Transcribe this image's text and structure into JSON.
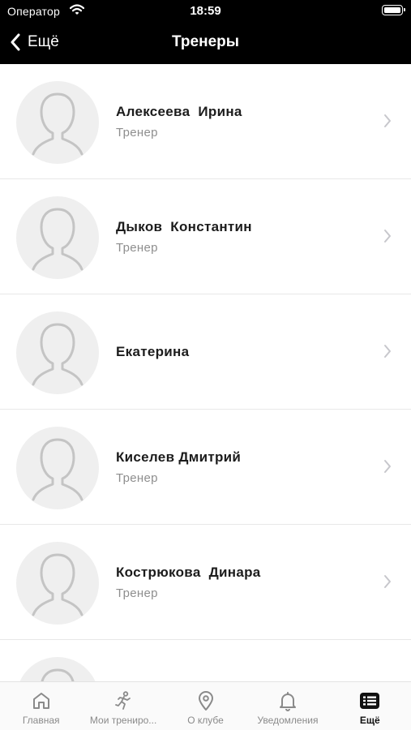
{
  "status_bar": {
    "carrier": "Оператор",
    "time": "18:59"
  },
  "nav": {
    "back_label": "Ещё",
    "title": "Тренеры"
  },
  "trainers": [
    {
      "name": "Алексеева  Ирина",
      "role": "Тренер"
    },
    {
      "name": "Дыков  Константин",
      "role": "Тренер"
    },
    {
      "name": "Екатерина",
      "role": ""
    },
    {
      "name": "Киселев Дмитрий",
      "role": "Тренер"
    },
    {
      "name": "Кострюкова  Динара",
      "role": "Тренер"
    },
    {
      "name": "",
      "role": ""
    }
  ],
  "tabs": [
    {
      "label": "Главная",
      "icon": "home-icon"
    },
    {
      "label": "Мои трениро...",
      "icon": "running-person-icon"
    },
    {
      "label": "О клубе",
      "icon": "location-pin-icon"
    },
    {
      "label": "Уведомления",
      "icon": "bell-icon"
    },
    {
      "label": "Ещё",
      "icon": "list-icon",
      "active": true
    }
  ],
  "colors": {
    "header_bg": "#000000",
    "avatar_bg": "#efefef",
    "secondary_text": "#8e8e8e",
    "tab_inactive": "#8a8a8a",
    "tab_active": "#111111"
  }
}
